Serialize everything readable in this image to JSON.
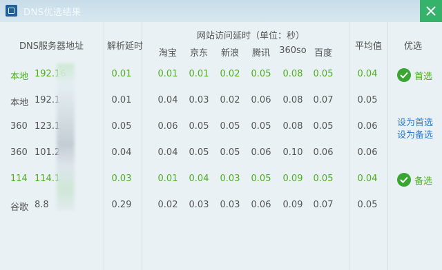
{
  "window": {
    "title": "DNS优选结果"
  },
  "headers": {
    "dns_server": "DNS服务器地址",
    "resolve_delay": "解析延时",
    "site_delay_group": "网站访问延时（单位：秒）",
    "sites": [
      "淘宝",
      "京东",
      "新浪",
      "腾讯",
      "360so",
      "百度"
    ],
    "average": "平均值",
    "preferred": "优选"
  },
  "rows": [
    {
      "name": "本地",
      "ip": "192.16",
      "resolve": "0.01",
      "sites": [
        "0.01",
        "0.01",
        "0.02",
        "0.05",
        "0.08",
        "0.05"
      ],
      "avg": "0.04",
      "highlight": true,
      "preferred": "首选"
    },
    {
      "name": "本地",
      "ip": "192.1",
      "resolve": "0.01",
      "sites": [
        "0.04",
        "0.03",
        "0.02",
        "0.06",
        "0.08",
        "0.07"
      ],
      "avg": "0.05",
      "highlight": false
    },
    {
      "name": "360",
      "ip": "123.1",
      "resolve": "0.05",
      "sites": [
        "0.06",
        "0.05",
        "0.05",
        "0.05",
        "0.08",
        "0.05"
      ],
      "avg": "0.06",
      "highlight": false,
      "actions": [
        "设为首选",
        "设为备选"
      ]
    },
    {
      "name": "360",
      "ip": "101.2",
      "resolve": "0.04",
      "sites": [
        "0.04",
        "0.05",
        "0.05",
        "0.06",
        "0.10",
        "0.06"
      ],
      "avg": "0.06",
      "highlight": false
    },
    {
      "name": "114",
      "ip": "114.1",
      "resolve": "0.03",
      "sites": [
        "0.01",
        "0.04",
        "0.03",
        "0.05",
        "0.09",
        "0.05"
      ],
      "avg": "0.04",
      "highlight": true,
      "preferred": "备选"
    },
    {
      "name": "谷歌",
      "ip": "8.8",
      "resolve": "0.29",
      "sites": [
        "0.02",
        "0.03",
        "0.03",
        "0.06",
        "0.09",
        "0.07"
      ],
      "avg": "0.05",
      "highlight": false
    }
  ],
  "colors": {
    "highlight": "#4caf1c",
    "normal": "#555555",
    "link": "#2b7bd0",
    "badge": "#3aa533"
  },
  "icons": {
    "app": "dns-app-icon",
    "close": "close-icon",
    "check": "check-icon"
  }
}
